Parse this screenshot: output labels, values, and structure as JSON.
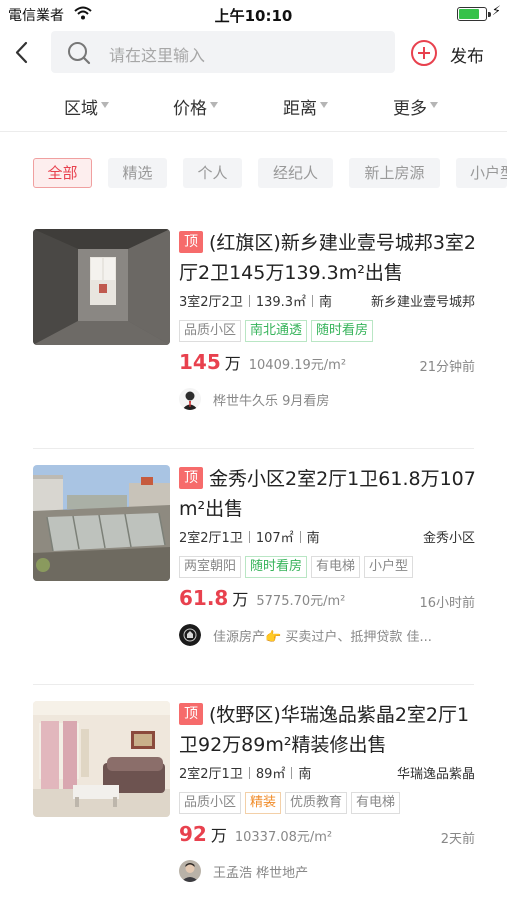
{
  "status_bar": {
    "carrier": "電信業者",
    "time": "上午10:10",
    "battery_level": 0.8
  },
  "header": {
    "search_placeholder": "请在这里输入",
    "publish_label": "发布"
  },
  "filters": [
    "区域",
    "价格",
    "距离",
    "更多"
  ],
  "tags": [
    {
      "label": "全部",
      "active": true
    },
    {
      "label": "精选",
      "active": false
    },
    {
      "label": "个人",
      "active": false
    },
    {
      "label": "经纪人",
      "active": false
    },
    {
      "label": "新上房源",
      "active": false
    },
    {
      "label": "小户型",
      "active": false
    }
  ],
  "listings": [
    {
      "badge": "顶",
      "title": "(红旗区)新乡建业壹号城邦3室2厅2卫145万139.3m²出售",
      "layout": "3室2厅2卫",
      "area": "139.3㎡",
      "orientation": "南",
      "community": "新乡建业壹号城邦",
      "features": [
        {
          "label": "品质小区",
          "style": "gray"
        },
        {
          "label": "南北通透",
          "style": "green"
        },
        {
          "label": "随时看房",
          "style": "green"
        }
      ],
      "price": "145",
      "price_unit": "万",
      "unit_price": "10409.19元/m²",
      "time_ago": "21分钟前",
      "agent": "桦世牛久乐 9月看房"
    },
    {
      "badge": "顶",
      "title": "金秀小区2室2厅1卫61.8万107m²出售",
      "layout": "2室2厅1卫",
      "area": "107㎡",
      "orientation": "南",
      "community": "金秀小区",
      "features": [
        {
          "label": "两室朝阳",
          "style": "gray"
        },
        {
          "label": "随时看房",
          "style": "green"
        },
        {
          "label": "有电梯",
          "style": "gray"
        },
        {
          "label": "小户型",
          "style": "gray"
        }
      ],
      "price": "61.8",
      "price_unit": "万",
      "unit_price": "5775.70元/m²",
      "time_ago": "16小时前",
      "agent": "佳源房产👉 买卖过户、抵押贷款 佳..."
    },
    {
      "badge": "顶",
      "title": "(牧野区)华瑞逸品紫晶2室2厅1卫92万89m²精装修出售",
      "layout": "2室2厅1卫",
      "area": "89㎡",
      "orientation": "南",
      "community": "华瑞逸品紫晶",
      "features": [
        {
          "label": "品质小区",
          "style": "gray"
        },
        {
          "label": "精装",
          "style": "orange"
        },
        {
          "label": "优质教育",
          "style": "gray"
        },
        {
          "label": "有电梯",
          "style": "gray"
        }
      ],
      "price": "92",
      "price_unit": "万",
      "unit_price": "10337.08元/m²",
      "time_ago": "2天前",
      "agent": "王孟浩 桦世地产"
    }
  ]
}
